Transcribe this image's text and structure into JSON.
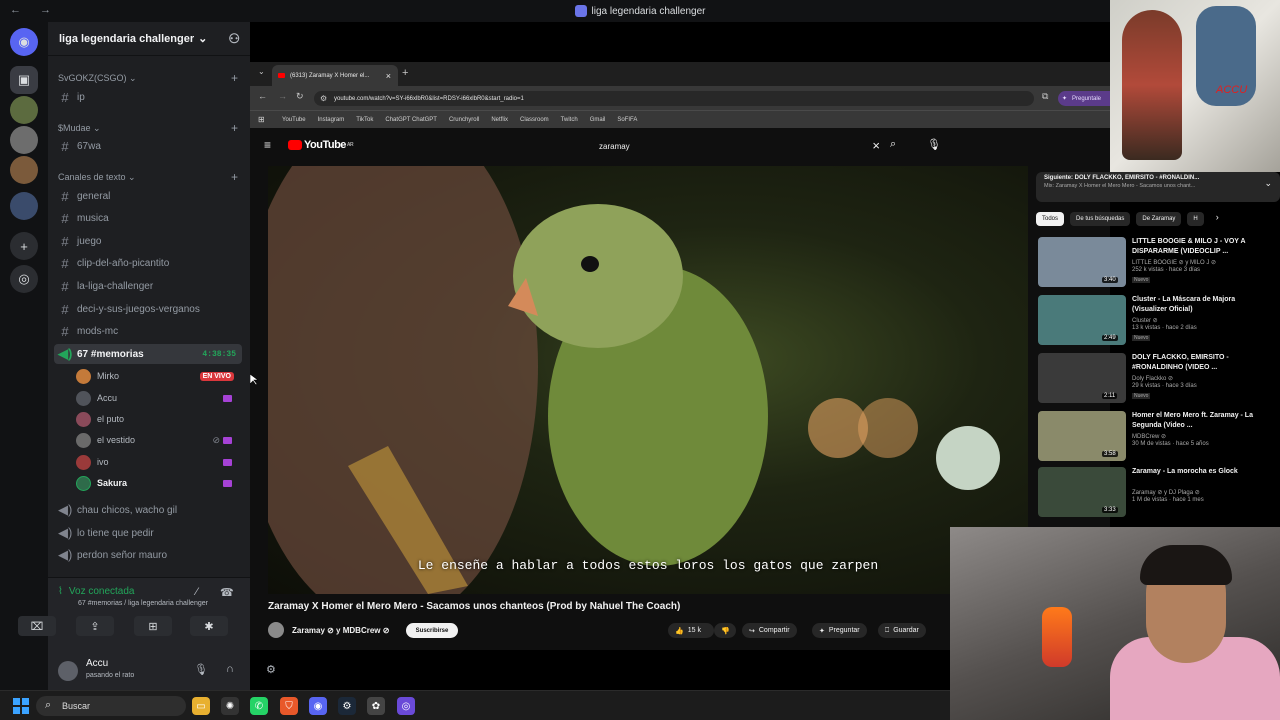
{
  "window": {
    "title": "liga legendaria challenger"
  },
  "discord": {
    "guild_name": "liga legendaria challenger",
    "categories": [
      {
        "name": "SvGOKZ(CSGO)",
        "channels": [
          "ip"
        ]
      },
      {
        "name": "$Mudae",
        "channels": [
          "67wa"
        ]
      },
      {
        "name": "Canales de texto",
        "channels": [
          "general",
          "musica",
          "juego",
          "clip-del-año-picantito",
          "la-liga-challenger",
          "deci-y-sus-juegos-verganos",
          "mods-mc"
        ]
      }
    ],
    "voice_channel": {
      "name": "67 #memorias",
      "timer": "4:38:35"
    },
    "voice_users": [
      {
        "name": "Mirko",
        "badge": "EN VIVO"
      },
      {
        "name": "Accu"
      },
      {
        "name": "el puto"
      },
      {
        "name": "el vestido"
      },
      {
        "name": "ivo"
      },
      {
        "name": "Sakura"
      }
    ],
    "other_voice_channels": [
      "chau chicos, wacho gil",
      "lo tiene que pedir",
      "perdon señor mauro"
    ],
    "voice_panel": {
      "status": "Voz conectada",
      "subtitle": "67 #memorias / liga legendaria challenger"
    },
    "user": {
      "name": "Accu",
      "status": "pasando el rato"
    }
  },
  "browser": {
    "tab_title": "(6313) Zaramay X Homer el...",
    "url": "youtube.com/watch?v=SY-i66xlbR0&list=RDSY-i66xlbR0&start_radio=1",
    "ask_label": "Preguntale",
    "bookmarks": [
      "YouTube",
      "Instagram",
      "TikTok",
      "ChatGPT ChatGPT",
      "Crunchyroll",
      "Netflix",
      "Classroom",
      "Twitch",
      "Gmail",
      "SoFIFA"
    ]
  },
  "youtube": {
    "logo": "YouTube",
    "logo_sup": "AR",
    "search_query": "zaramay",
    "subtitle": "Le enseñe a hablar a todos estos loros los gatos que zarpen",
    "video_title": "Zaramay X Homer el Mero Mero - Sacamos unos chanteos (Prod by Nahuel The Coach)",
    "channel": "Zaramay ⊘ y MDBCrew ⊘",
    "subscribe": "Suscribirse",
    "likes": "15 k",
    "share": "Compartir",
    "ask": "Preguntar",
    "save": "Guardar",
    "up_next_title": "Siguiente: DOLY FLACKKO, EMIRSITO - #RONALDIN...",
    "up_next_sub": "Mix: Zaramay X Homer el Mero Mero - Sacamos unos chant...",
    "chips": [
      "Todos",
      "De tus búsquedas",
      "De Zaramay",
      "H"
    ],
    "recommendations": [
      {
        "title": "LITTLE BOOGIE & MILO J - VOY A DISPARARME (VIDEOCLIP ...",
        "channel": "LITTLE BOOGIE ⊘ y MILO J ⊘",
        "views": "252 k vistas · hace 3 días",
        "badge": "Nuevo",
        "duration": "3:40"
      },
      {
        "title": "Cluster - La Máscara de Majora (Visualizer Oficial)",
        "channel": "Cluster ⊘",
        "views": "13 k vistas · hace 2 días",
        "badge": "Nuevo",
        "duration": "2:49"
      },
      {
        "title": "DOLY FLACKKO, EMIRSITO - #RONALDINHO (VIDEO ...",
        "channel": "Doly Flackko ⊘",
        "views": "29 k vistas · hace 3 días",
        "badge": "Nuevo",
        "duration": "2:11"
      },
      {
        "title": "Homer el Mero Mero ft. Zaramay - La Segunda (Video ...",
        "channel": "MDBCrew ⊘",
        "views": "30 M de vistas · hace 5 años",
        "badge": "",
        "duration": "3:58"
      },
      {
        "title": "Zaramay - La morocha es Glock",
        "channel": "Zaramay ⊘ y DJ Plaga ⊘",
        "views": "1 M de vistas · hace 1 mes",
        "badge": "",
        "duration": "3:33"
      }
    ]
  },
  "stream": {
    "overlay_text": "ACCU"
  },
  "taskbar": {
    "search_placeholder": "Buscar"
  },
  "colors": {
    "discord_bg": "#1e1f22",
    "voice_green": "#23a55a",
    "live_red": "#da373c",
    "yt_red": "#ff0000"
  }
}
